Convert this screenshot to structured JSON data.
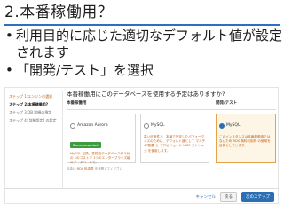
{
  "slide": {
    "title": "2.本番稼働用？",
    "bullets": [
      "利用目的に応じた適切なデフォルト値が設定されます",
      "「開発/テスト」を選択"
    ]
  },
  "wizard": {
    "steps": [
      "ステップ 1:エンジンの選択",
      "ステップ 2:本番稼働用?",
      "ステップ 3:DB 詳細の指定",
      "ステップ 4:[詳細設定] の設定"
    ],
    "question": "本番稼働用にこのデータベースを使用する予定はありますか?",
    "production_label": "本番稼働用",
    "devtest_label": "開発/テスト",
    "options": [
      {
        "name": "Amazon Aurora",
        "badge": "Recommended",
        "desc": "MySQL 互換、高性能データベースが 5分の 1のコストで 1つのエンタープライズ級のデータベースで。"
      },
      {
        "name": "MySQL",
        "badge": "",
        "desc": "高い可用性と、本番で安定したパフォーマンスのために、デフォルト値として マルチAZ配置 と プロビジョンド IOPS ストレージ を使用します。"
      },
      {
        "name": "MySQL",
        "badge": "",
        "desc": "このインスタンスは本番稼働用ではないため RDS 無料利用枠 の使用を目的としています。"
      }
    ],
    "note_prefix": "料金は ",
    "note_link": "RDS 料金表",
    "note_suffix": " を参照してください",
    "buttons": {
      "cancel": "キャンセル",
      "back": "戻る",
      "next": "次のステップ"
    }
  }
}
